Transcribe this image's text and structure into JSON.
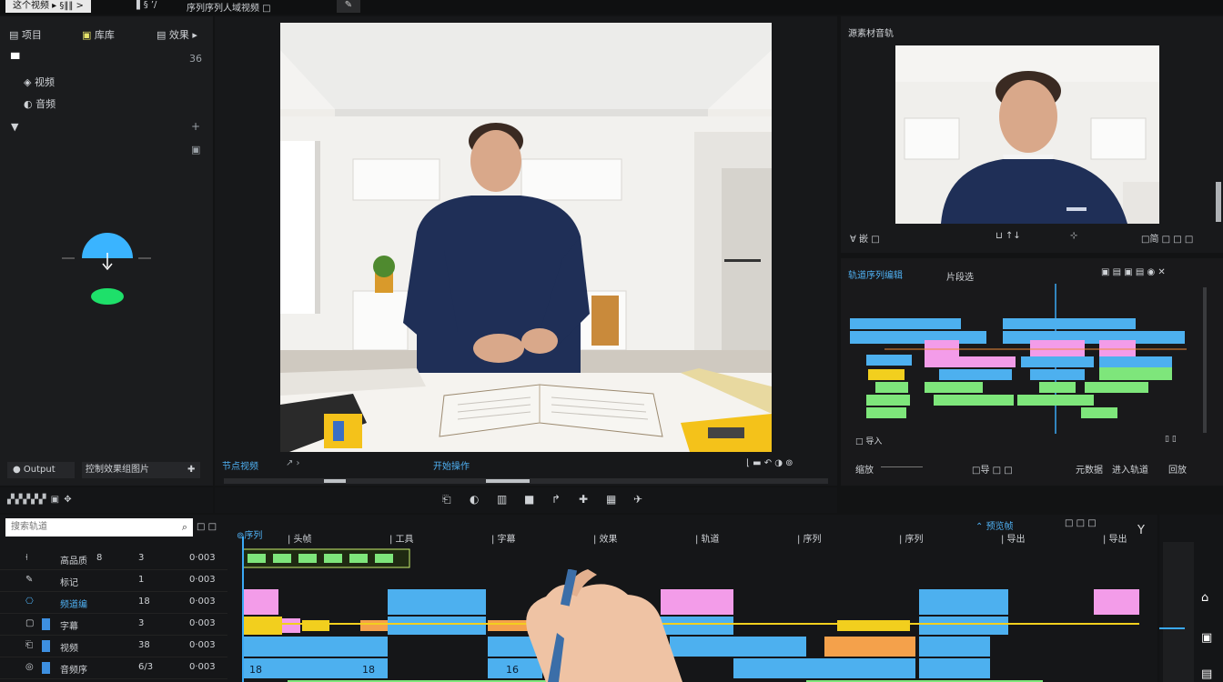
{
  "topbar": {
    "title": "这个视频 ▸ §‖‖ >",
    "tab2": "▌§ ’/",
    "tab3": "序列序列人域视频 □"
  },
  "left_panel": {
    "tabs": [
      "项目",
      "库库",
      "效果 ▸"
    ],
    "tree_header_count": "36",
    "tree_items": [
      "视频",
      "音频"
    ],
    "bottom_left": "Output",
    "bottom_right": "控制效果组图片"
  },
  "program_monitor": {
    "timecode_label": "节点视频",
    "mid_label": "开始操作",
    "scene_colors": {
      "wall": "#f2f0ec",
      "floor": "#cfc9c0",
      "sweater": "#1f2f57",
      "table": "#f5f3ef",
      "accent_yellow": "#f4c21a"
    }
  },
  "source_monitor": {
    "title": "源素材音轨",
    "left_controls": "∀ 嵌 □",
    "mid_control": "⊔ ↑↓",
    "right_controls": "□简 □ □ □"
  },
  "sequence_panel": {
    "title": "轨道序列编辑",
    "subtitle": "片段选",
    "footer_left": "□ 导入",
    "footer_mid": "□导 □ □",
    "footer_right_1": "元数据",
    "footer_right_2": "进入轨道",
    "footer_right_3": "回放",
    "zoom_label": "缩放"
  },
  "transport": {
    "buttons": [
      "mark-in-icon",
      "step-back-icon",
      "play-back-icon",
      "stop-icon",
      "play-icon",
      "step-forward-icon",
      "mark-out-icon",
      "export-frame-icon"
    ]
  },
  "timeline": {
    "search_placeholder": "搜索轨道",
    "header_toggle": "□ □",
    "tab_label": "序列",
    "ruler_labels": [
      "头帧",
      "工具",
      "字幕",
      "效果",
      "轨道",
      "序列",
      "序列",
      "导出",
      "导出"
    ],
    "top_right_label": "预览帧",
    "top_right_icons": "□ □ □",
    "tracks": [
      {
        "name": "高品质",
        "col1": "8",
        "col2": "3",
        "col3": "0·003"
      },
      {
        "name": "标记",
        "col1": "",
        "col2": "1",
        "col3": "0·003"
      },
      {
        "name": "频道编",
        "col1": "",
        "col2": "18",
        "col3": "0·003"
      },
      {
        "name": "字幕",
        "col1": "",
        "col2": "3",
        "col3": "0·003"
      },
      {
        "name": "视频",
        "col1": "",
        "col2": "38",
        "col3": "0·003"
      },
      {
        "name": "音频序",
        "col1": "",
        "col2": "6/3",
        "col3": "0·003"
      }
    ],
    "clip_texts": [
      "18",
      "18",
      "16"
    ],
    "colors": {
      "pink": "#f39ce9",
      "blue": "#4db0ef",
      "yellow": "#f2cf1e",
      "green": "#7ee67b",
      "lime": "#c9f06e",
      "orange": "#f4a14b"
    }
  },
  "right_tools": [
    "□",
    "□",
    "□"
  ]
}
